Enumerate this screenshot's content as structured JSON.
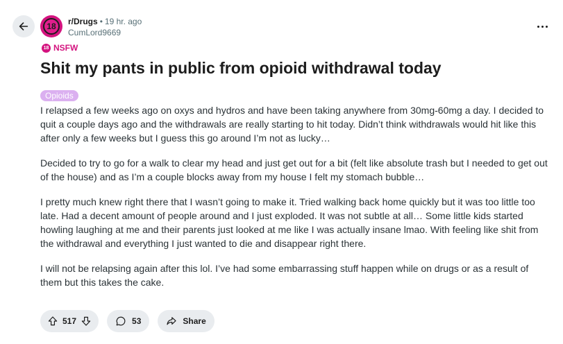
{
  "header": {
    "subreddit": "r/Drugs",
    "separator": "•",
    "age": "19 hr. ago",
    "author": "CumLord9669",
    "avatar_text": "18"
  },
  "nsfw": {
    "badge": "18",
    "label": "NSFW"
  },
  "post": {
    "title": "Shit my pants in public from opioid withdrawal today",
    "flair": "Opioids",
    "paragraphs": [
      "I relapsed a few weeks ago on oxys and hydros and have been taking anywhere from 30mg-60mg a day. I decided to quit a couple days ago and the withdrawals are really starting to hit today. Didn’t think withdrawals would hit like this after only a few weeks but I guess this go around I’m not as lucky…",
      "Decided to try to go for a walk to clear my head and just get out for a bit (felt like absolute trash but I needed to get out of the house) and as I’m a couple blocks away from my house I felt my stomach bubble…",
      "I pretty much knew right there that I wasn’t going to make it. Tried walking back home quickly but it was too little too late. Had a decent amount of people around and I just exploded. It was not subtle at all… Some little kids started howling laughing at me and their parents just looked at me like I was actually insane lmao. With feeling like shit from the withdrawal and everything I just wanted to die and disappear right there.",
      "I will not be relapsing again after this lol. I’ve had some embarrassing stuff happen while on drugs or as a result of them but this takes the cake."
    ]
  },
  "actions": {
    "votes": "517",
    "comments": "53",
    "share_label": "Share"
  },
  "colors": {
    "nsfw": "#d4137f",
    "flair_bg": "#dbb0f0",
    "pill_bg": "#e9ecef"
  }
}
